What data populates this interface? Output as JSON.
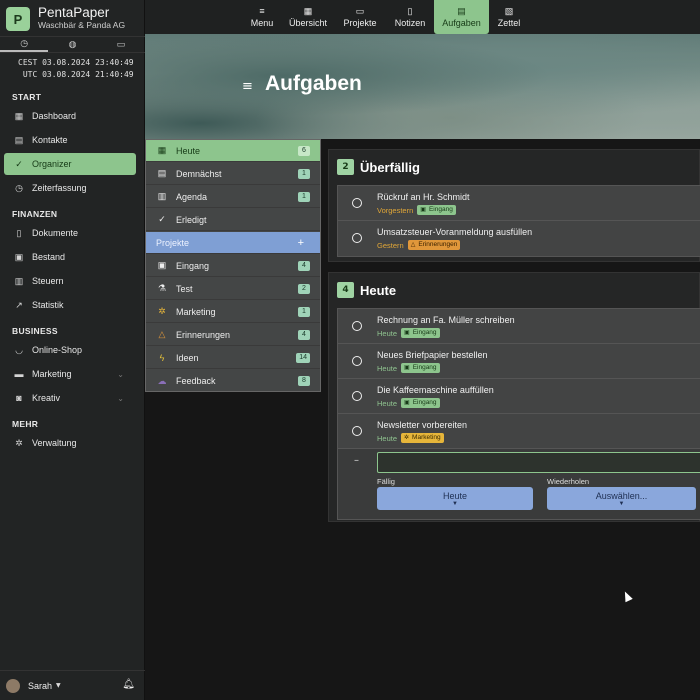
{
  "brand": {
    "logo_letter": "P",
    "name": "PentaPaper",
    "company": "Waschbär & Panda AG"
  },
  "clock": {
    "tabs": [
      "clock-icon",
      "globe-icon",
      "calendar-icon"
    ],
    "lines": [
      "CEST 03.08.2024 23:40:49",
      " UTC 03.08.2024 21:40:49"
    ]
  },
  "sidebar": {
    "sections": {
      "start": "START",
      "finanzen": "FINANZEN",
      "business": "BUSINESS",
      "mehr": "MEHR"
    },
    "items": [
      {
        "label": "Dashboard",
        "icon": "dashboard-icon"
      },
      {
        "label": "Kontakte",
        "icon": "contacts-icon"
      },
      {
        "label": "Organizer",
        "icon": "check-circle-icon"
      },
      {
        "label": "Zeiterfassung",
        "icon": "clock-icon"
      },
      {
        "label": "Dokumente",
        "icon": "document-icon"
      },
      {
        "label": "Bestand",
        "icon": "inventory-icon"
      },
      {
        "label": "Steuern",
        "icon": "tax-icon"
      },
      {
        "label": "Statistik",
        "icon": "chart-icon"
      },
      {
        "label": "Online-Shop",
        "icon": "basket-icon"
      },
      {
        "label": "Marketing",
        "icon": "marketing-icon"
      },
      {
        "label": "Kreativ",
        "icon": "camera-icon"
      },
      {
        "label": "Verwaltung",
        "icon": "settings-icon"
      }
    ],
    "user": "Sarah"
  },
  "topnav": {
    "items": [
      {
        "label": "Menu",
        "icon": "menu-icon"
      },
      {
        "label": "Übersicht",
        "icon": "overview-icon"
      },
      {
        "label": "Projekte",
        "icon": "briefcase-icon"
      },
      {
        "label": "Notizen",
        "icon": "notes-icon"
      },
      {
        "label": "Aufgaben",
        "icon": "tasks-icon"
      },
      {
        "label": "Zettel",
        "icon": "sticky-note-icon"
      }
    ],
    "active": "Aufgaben"
  },
  "page": {
    "title": "Aufgaben"
  },
  "filters": {
    "items": [
      {
        "label": "Heute",
        "count": "6"
      },
      {
        "label": "Demnächst",
        "count": "1"
      },
      {
        "label": "Agenda",
        "count": "1"
      },
      {
        "label": "Erledigt",
        "count": ""
      }
    ],
    "projects_header": "Projekte",
    "projects": [
      {
        "label": "Eingang",
        "count": "4"
      },
      {
        "label": "Test",
        "count": "2"
      },
      {
        "label": "Marketing",
        "count": "1"
      },
      {
        "label": "Erinnerungen",
        "count": "4"
      },
      {
        "label": "Ideen",
        "count": "14"
      },
      {
        "label": "Feedback",
        "count": "8"
      }
    ]
  },
  "overdue": {
    "count": "2",
    "title": "Überfällig",
    "tasks": [
      {
        "title": "Rückruf an Hr. Schmidt",
        "due": "Vorgestern",
        "tag": "Eingang",
        "tag_color": "#8dc58d"
      },
      {
        "title": "Umsatzsteuer-Voranmeldung ausfüllen",
        "due": "Gestern",
        "tag": "Erinnerungen",
        "tag_color": "#e0973a"
      }
    ]
  },
  "today": {
    "count": "4",
    "title": "Heute",
    "tasks": [
      {
        "title": "Rechnung an Fa. Müller schreiben",
        "due": "Heute",
        "tag": "Eingang",
        "tag_color": "#8dc58d"
      },
      {
        "title": "Neues Briefpapier bestellen",
        "due": "Heute",
        "tag": "Eingang",
        "tag_color": "#8dc58d"
      },
      {
        "title": "Die Kaffeemaschine auffüllen",
        "due": "Heute",
        "tag": "Eingang",
        "tag_color": "#8dc58d"
      },
      {
        "title": "Newsletter vorbereiten",
        "due": "Heute",
        "tag": "Marketing",
        "tag_color": "#e6b53a"
      }
    ],
    "new_task": {
      "due_label": "Fällig",
      "due_value": "Heute",
      "repeat_label": "Wiederholen",
      "repeat_value": "Auswählen..."
    }
  },
  "colors": {
    "accent": "#8dc58d",
    "project_blue": "#7f9fd4",
    "overdue_orange": "#e0a637"
  }
}
